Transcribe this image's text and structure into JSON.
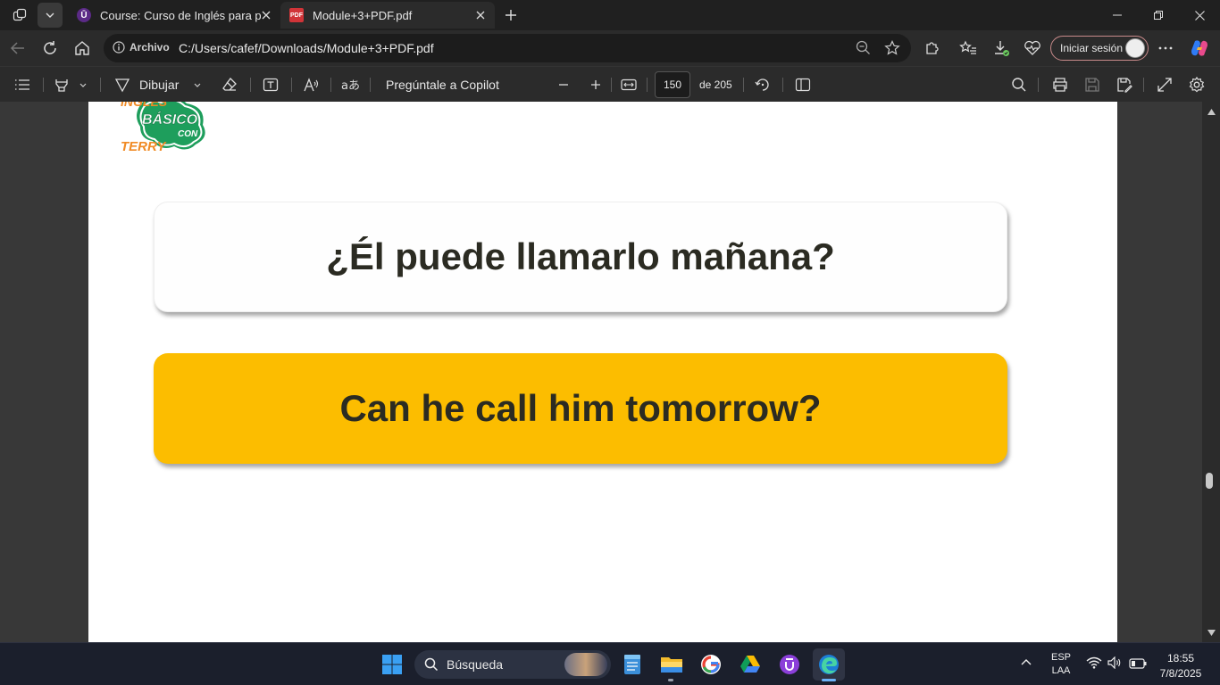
{
  "tabs": [
    {
      "title": "Course: Curso de Inglés para principiantes",
      "active": false
    },
    {
      "title": "Module+3+PDF.pdf",
      "active": true
    }
  ],
  "address": {
    "label": "Archivo",
    "url": "C:/Users/cafef/Downloads/Module+3+PDF.pdf"
  },
  "signin_label": "Iniciar sesión",
  "pdf_toolbar": {
    "draw_label": "Dibujar",
    "copilot_label": "Pregúntale a Copilot",
    "page_current": "150",
    "page_total": "de 205"
  },
  "page": {
    "logo": {
      "line1": "INGLES",
      "line2": "BÁSICO",
      "line3": "CON",
      "line4": "TERRY"
    },
    "card_question": "¿Él puede llamarlo mañana?",
    "card_answer": "Can he call him tomorrow?",
    "colors": {
      "answer_bg": "#fcbd00",
      "text": "#2b2b22"
    }
  },
  "taskbar": {
    "search_placeholder": "Búsqueda",
    "lang_top": "ESP",
    "lang_bottom": "LAA",
    "time": "18:55",
    "date": "7/8/2025"
  }
}
